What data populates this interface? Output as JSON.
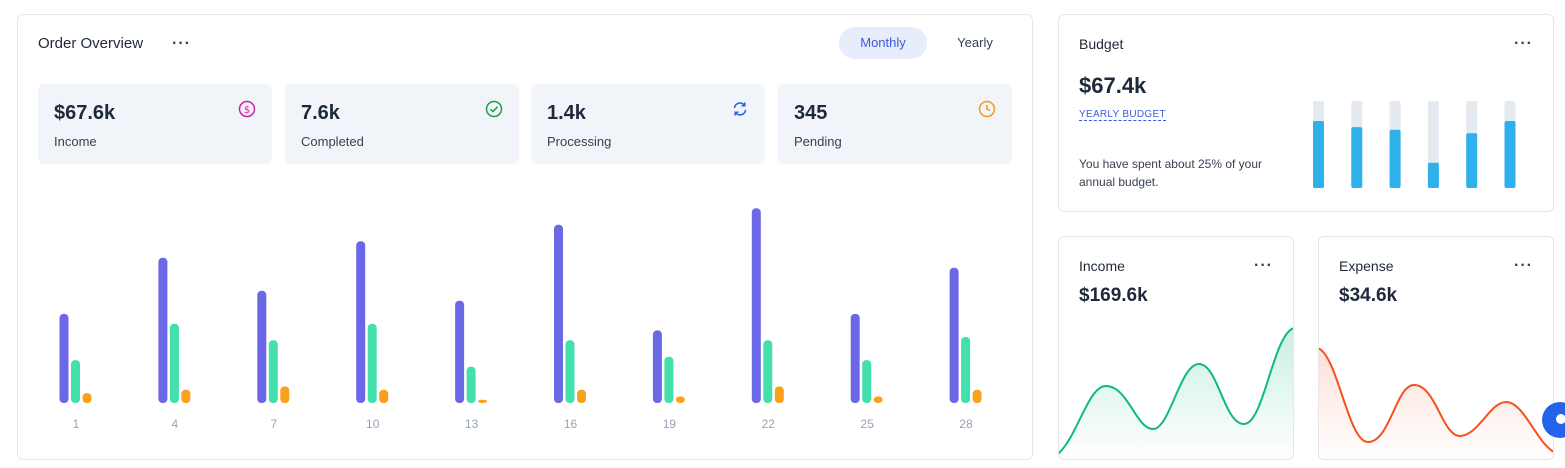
{
  "order_overview": {
    "title": "Order Overview",
    "more_label": "···",
    "toggle": {
      "monthly": "Monthly",
      "yearly": "Yearly",
      "selected": "Monthly"
    },
    "stats": [
      {
        "value": "$67.6k",
        "label": "Income",
        "icon": "dollar-circle-icon",
        "color": "#d020a8"
      },
      {
        "value": "7.6k",
        "label": "Completed",
        "icon": "check-circle-icon",
        "color": "#16a34a"
      },
      {
        "value": "1.4k",
        "label": "Processing",
        "icon": "refresh-icon",
        "color": "#2563eb"
      },
      {
        "value": "345",
        "label": "Pending",
        "icon": "clock-icon",
        "color": "#f59e0b"
      }
    ]
  },
  "budget": {
    "title": "Budget",
    "more_label": "···",
    "amount": "$67.4k",
    "link_label": "YEARLY BUDGET",
    "note": "You have spent about 25% of your annual budget.",
    "bar_levels": [
      0.77,
      0.7,
      0.67,
      0.29,
      0.63,
      0.77
    ],
    "bar_color": "#2eb0ea",
    "track_color": "#e5e9f0"
  },
  "income": {
    "title": "Income",
    "more_label": "···",
    "amount": "$169.6k",
    "line_color": "#10b981"
  },
  "expense": {
    "title": "Expense",
    "more_label": "···",
    "amount": "$34.6k",
    "line_color": "#f4511e"
  },
  "chart_data": [
    {
      "type": "bar",
      "categories": [
        "1",
        "4",
        "7",
        "10",
        "13",
        "16",
        "19",
        "22",
        "25",
        "28"
      ],
      "series": [
        {
          "values": [
            54,
            88,
            68,
            98,
            62,
            108,
            44,
            118,
            54,
            82
          ],
          "color": "#6b68e6"
        },
        {
          "values": [
            26,
            48,
            38,
            48,
            22,
            38,
            28,
            38,
            26,
            40
          ],
          "color": "#44e0ac"
        },
        {
          "values": [
            6,
            8,
            10,
            8,
            2,
            8,
            4,
            10,
            4,
            8
          ],
          "color": "#f9a11b"
        }
      ],
      "ylim": [
        0,
        120
      ]
    }
  ]
}
